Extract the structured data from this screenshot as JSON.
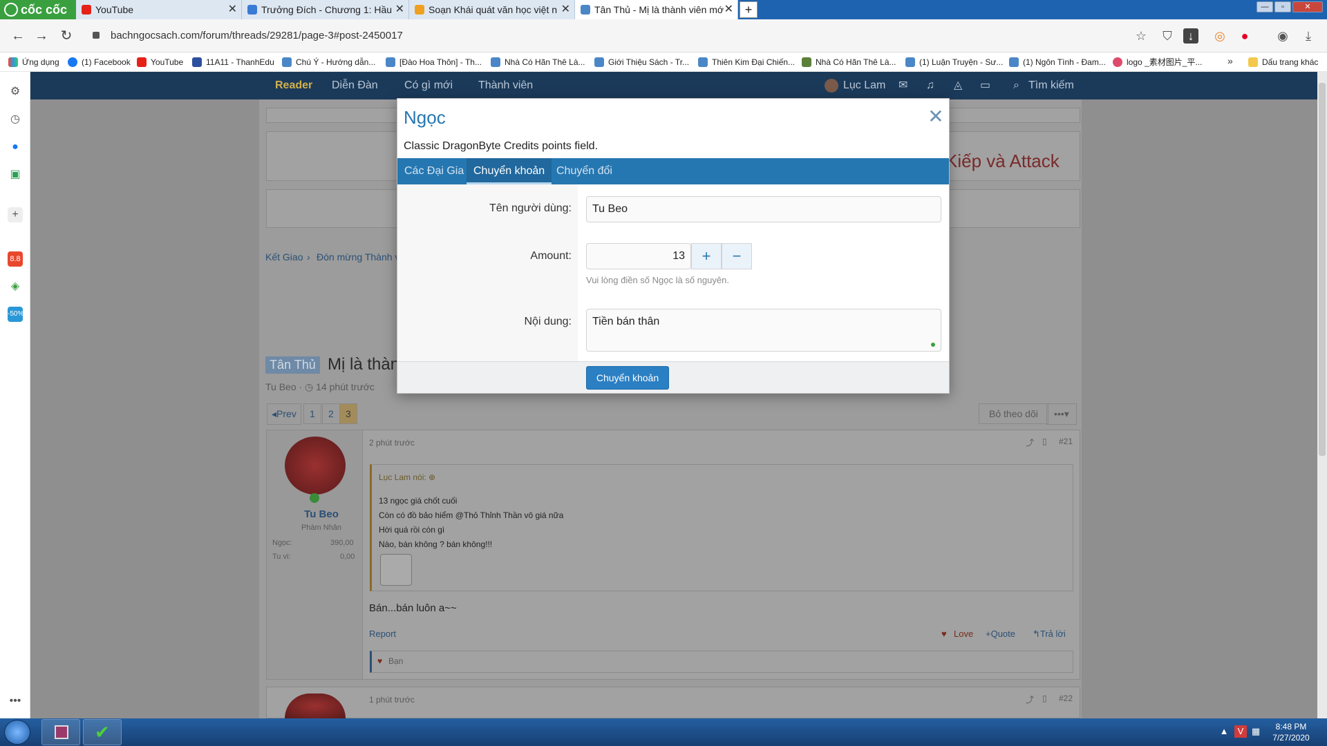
{
  "browser": {
    "brand": "cốc cốc",
    "tabs": [
      {
        "title": "YouTube",
        "icon": "youtube-icon"
      },
      {
        "title": "Trưởng Đích - Chương 1: Hầu",
        "icon": "book-icon"
      },
      {
        "title": "Soạn Khái quát văn học việt n",
        "icon": "orange-icon"
      },
      {
        "title": "Tân Thủ - Mị là thành viên mớ",
        "icon": "page-icon",
        "active": true
      }
    ],
    "url": "bachngocsach.com/forum/threads/29281/page-3#post-2450017",
    "bookmarks": [
      {
        "label": "Ứng dụng",
        "icon": "apps-icon"
      },
      {
        "label": "(1) Facebook",
        "icon": "facebook-icon"
      },
      {
        "label": "YouTube",
        "icon": "youtube-icon"
      },
      {
        "label": "11A11 - ThanhEdu",
        "icon": "book-icon"
      },
      {
        "label": "Chú Ý - Hướng dẫn...",
        "icon": "page-icon"
      },
      {
        "label": "[Đào Hoa Thôn] - Th...",
        "icon": "page-icon"
      },
      {
        "label": "Nhà Có Hãn Thê Là...",
        "icon": "page-icon"
      },
      {
        "label": "Giới Thiệu Sách - Tr...",
        "icon": "page-icon"
      },
      {
        "label": "Thiên Kim Đại Chiến...",
        "icon": "page-icon"
      },
      {
        "label": "Nhà Có Hãn Thê Là...",
        "icon": "grid-icon"
      },
      {
        "label": "(1) Luận Truyện - Sư...",
        "icon": "page-icon"
      },
      {
        "label": "(1) Ngôn Tình - Đam...",
        "icon": "page-icon"
      },
      {
        "label": "logo _素材图片_平...",
        "icon": "pink-icon"
      },
      {
        "label": "Dấu trang khác",
        "icon": "folder-icon"
      }
    ]
  },
  "forum": {
    "nav": [
      "Reader",
      "Diễn Đàn",
      "Có gì mới",
      "Thành viên"
    ],
    "user": "Lục Lam",
    "search": "Tìm kiếm",
    "banner_text": "Kiếp và Attack",
    "breadcrumb": [
      "Kết Giao",
      "Đón mừng Thành v"
    ],
    "thread_prefix": "Tân Thủ",
    "thread_title": "Mị là thàn",
    "thread_meta": "Tu Beo · ◷ 14 phút trước",
    "pagination": [
      "◂Prev",
      "1",
      "2",
      "3"
    ],
    "follow_button": "Bỏ theo dõi",
    "more_button": "•••▾",
    "posts": [
      {
        "time": "2 phút trước",
        "number": "#21",
        "author": "Tu Beo",
        "rank": "Phàm Nhân",
        "stats": [
          {
            "k": "Ngọc:",
            "v": "390,00"
          },
          {
            "k": "Tu vi:",
            "v": "0,00"
          }
        ],
        "quote_author": "Lục Lam nói: ⊕",
        "quote_lines": [
          "13 ngọc giá chốt cuối",
          "Còn có đồ bảo hiểm @Thỏ Thỉnh Thần vô giá nữa",
          "Hời quá rồi còn gì",
          "Nào, bán không ? bán không!!!"
        ],
        "body": "Bán...bán luôn a~~",
        "report": "Report",
        "actions": [
          "Love",
          "+Quote",
          "↰Trả lời"
        ],
        "reaction": "Bạn"
      },
      {
        "time": "1 phút trước",
        "number": "#22"
      }
    ]
  },
  "modal": {
    "title": "Ngọc",
    "description": "Classic DragonByte Credits points field.",
    "tabs": [
      "Các Đại Gia",
      "Chuyển khoản",
      "Chuyển đổi"
    ],
    "active_tab": 1,
    "username_label": "Tên người dùng:",
    "username_value": "Tu Beo",
    "amount_label": "Amount:",
    "amount_value": "13",
    "amount_hint": "Vui lòng điền số Ngọc là số nguyên.",
    "message_label": "Nội dung:",
    "message_value": "Tiền bán thân",
    "submit_label": "Chuyển khoản"
  },
  "taskbar": {
    "time": "8:48 PM",
    "date": "7/27/2020"
  },
  "colors": {
    "accent": "#2577b1",
    "coccoc_green": "#3aa03f",
    "tab_strip": "#1e63b0"
  }
}
